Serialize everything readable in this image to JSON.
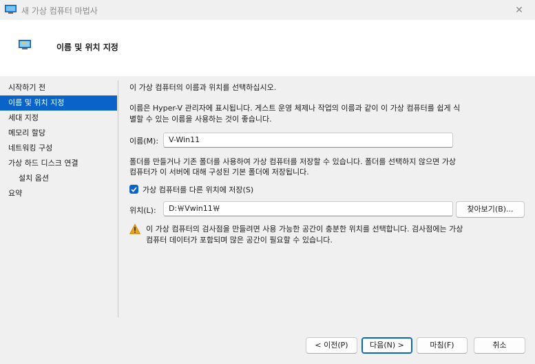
{
  "window": {
    "title": "새 가상 컴퓨터 마법사",
    "close_glyph": "✕"
  },
  "header": {
    "title": "이름 및 위치 지정"
  },
  "nav": {
    "items": [
      {
        "label": "시작하기 전"
      },
      {
        "label": "이름 및 위치 지정",
        "selected": true
      },
      {
        "label": "세대 지정"
      },
      {
        "label": "메모리 할당"
      },
      {
        "label": "네트워킹 구성"
      },
      {
        "label": "가상 하드 디스크 연결"
      },
      {
        "label": "설치 옵션",
        "sub": true
      },
      {
        "label": "요약"
      }
    ]
  },
  "main": {
    "intro": "이 가상 컴퓨터의 이름과 위치를 선택하십시오.",
    "desc_line1": "이름은 Hyper-V 관리자에 표시됩니다. 게스트 운영 체제나 작업의 이름과 같이 이 가상 컴퓨터를 쉽게 식",
    "desc_line2": "별할 수 있는 이름을 사용하는 것이 좋습니다.",
    "name_label": "이름(M):",
    "name_value": "V-Win11",
    "folder_line1": "폴더를 만들거나 기존 폴더를 사용하여 가상 컴퓨터를 저장할 수 있습니다. 폴더를 선택하지 않으면 가상",
    "folder_line2": "컴퓨터가 이 서버에 대해 구성된 기본 폴더에 저장됩니다.",
    "store_checkbox_label": "가상 컴퓨터를 다른 위치에 저장(S)",
    "store_checked": true,
    "location_label": "위치(L):",
    "location_value": "D:￦Vwin11￦",
    "browse_label": "찾아보기(B)...",
    "warning_line1": "이 가상 컴퓨터의 검사점을 만들려면 사용 가능한 공간이 충분한 위치를 선택합니다. 검사점에는 가상",
    "warning_line2": "컴퓨터 데이터가 포함되며 많은 공간이 필요할 수 있습니다."
  },
  "footer": {
    "prev_label": "< 이전(P)",
    "next_label": "다음(N) >",
    "finish_label": "마침(F)",
    "cancel_label": "취소"
  },
  "colors": {
    "accent": "#0a63c9",
    "warning": "#e8a317"
  }
}
